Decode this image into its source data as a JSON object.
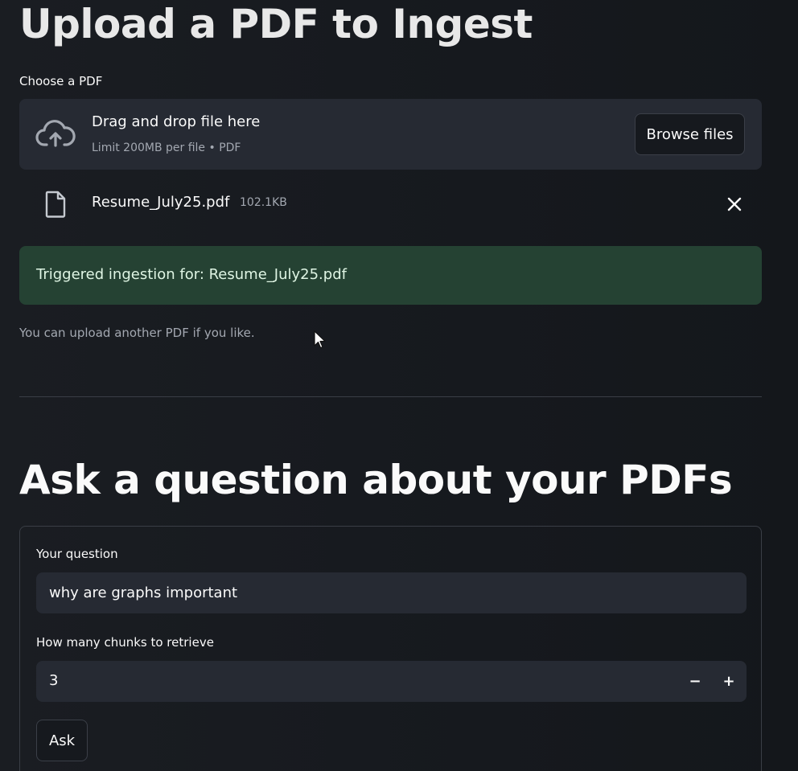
{
  "upload_section": {
    "title": "Upload a PDF to Ingest",
    "choose_label": "Choose a PDF",
    "dropzone_title": "Drag and drop file here",
    "dropzone_subtitle": "Limit 200MB per file • PDF",
    "browse_label": "Browse files",
    "file": {
      "name": "Resume_July25.pdf",
      "size": "102.1KB"
    },
    "success_message": "Triggered ingestion for: Resume_July25.pdf",
    "hint": "You can upload another PDF if you like."
  },
  "ask_section": {
    "title": "Ask a question about your PDFs",
    "question_label": "Your question",
    "question_value": "why are graphs important",
    "chunks_label": "How many chunks to retrieve",
    "chunks_value": "3",
    "decrement_symbol": "−",
    "increment_symbol": "+",
    "ask_label": "Ask"
  },
  "colors": {
    "background": "#16191e",
    "panel": "#262a33",
    "success_bg": "#254233",
    "text": "#fafafa",
    "muted": "#a3a8b1"
  },
  "icons": {
    "upload": "cloud-upload-icon",
    "file": "file-icon",
    "remove": "close-icon",
    "pointer": "mouse-cursor-icon"
  }
}
